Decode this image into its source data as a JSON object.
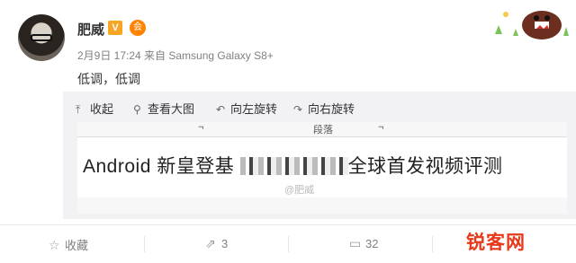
{
  "post": {
    "username": "肥威",
    "verified_badge": "V",
    "vip_icon": "会",
    "meta": "2月9日 17:24 来自 Samsung Galaxy S8+",
    "text": "低调，低调"
  },
  "toolbar": {
    "collapse": "收起",
    "view_large": "查看大图",
    "rotate_left": "向左旋转",
    "rotate_right": "向右旋转"
  },
  "image": {
    "top_fragment": "段落",
    "headline_left": "Android 新皇登基",
    "headline_right": "全球首发视频评测",
    "watermark": "@肥威"
  },
  "actions": {
    "favorite": "收藏",
    "repost_count": "3",
    "comment_count": "32"
  },
  "site_logo": {
    "mark": "锐客网"
  },
  "icons": {
    "collapse": "collapse-arrow-icon",
    "view_large": "magnifier-icon",
    "rotate_left": "rotate-left-icon",
    "rotate_right": "rotate-right-icon",
    "favorite": "star-icon",
    "repost": "share-icon",
    "comment": "comment-icon"
  },
  "colors": {
    "accent": "#ff8200",
    "verified": "#f6a623",
    "logo": "#e8381a"
  }
}
